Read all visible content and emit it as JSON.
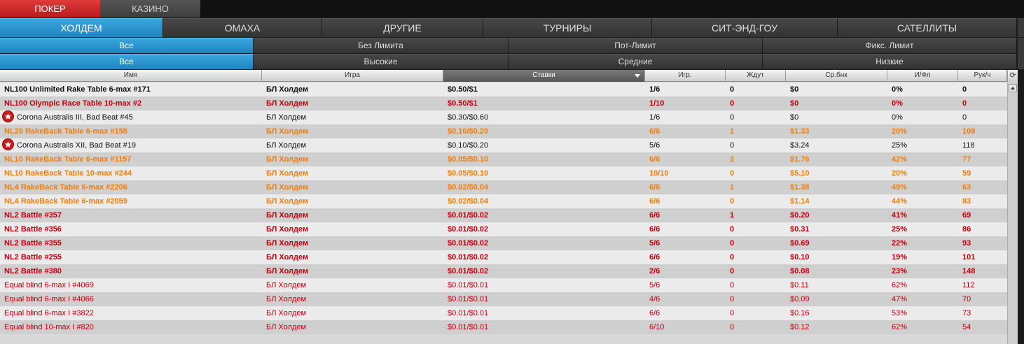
{
  "top_tabs": [
    {
      "label": "ПОКЕР",
      "active": true
    },
    {
      "label": "КАЗИНО",
      "active": false
    }
  ],
  "game_tabs": [
    "ХОЛДЕМ",
    "ОМАХА",
    "ДРУГИЕ",
    "ТУРНИРЫ",
    "СИТ-ЭНД-ГОУ",
    "САТЕЛЛИТЫ"
  ],
  "limit_tabs": [
    "Все",
    "Без Лимита",
    "Пот-Лимит",
    "Фикс. Лимит"
  ],
  "stake_tabs": [
    "Все",
    "Высокие",
    "Средние",
    "Низкие"
  ],
  "columns": [
    "Имя",
    "Игра",
    "Ставки",
    "Игр.",
    "Ждут",
    "Ср.бнк",
    "И/Фл",
    "Рук/ч"
  ],
  "icons": {
    "refresh": "refresh-icon",
    "star": "star-badge-icon",
    "sort": "sort-desc-icon"
  },
  "colors": {
    "accent": "#2196d3",
    "red": "#c3000d",
    "orange": "#f07d10"
  },
  "rows": [
    {
      "name": "NL100 Unlimited Rake Table 6-max #171",
      "game": "БЛ Холдем",
      "stakes": "$0.50/$1",
      "players": "1/6",
      "waiting": "0",
      "avg_pot": "$0",
      "flop": "0%",
      "hands": "0",
      "style": "black",
      "bold": true,
      "star": false
    },
    {
      "name": "NL100 Olympic Race Table 10-max #2",
      "game": "БЛ Холдем",
      "stakes": "$0.50/$1",
      "players": "1/10",
      "waiting": "0",
      "avg_pot": "$0",
      "flop": "0%",
      "hands": "0",
      "style": "red",
      "bold": true,
      "star": false
    },
    {
      "name": "Corona Australis III, Bad Beat #45",
      "game": "БЛ Холдем",
      "stakes": "$0.30/$0.60",
      "players": "1/6",
      "waiting": "0",
      "avg_pot": "$0",
      "flop": "0%",
      "hands": "0",
      "style": "black",
      "bold": false,
      "star": true
    },
    {
      "name": "NL20 RakeBack Table 6-max #158",
      "game": "БЛ Холдем",
      "stakes": "$0.10/$0.20",
      "players": "6/6",
      "waiting": "1",
      "avg_pot": "$1.33",
      "flop": "20%",
      "hands": "109",
      "style": "orange",
      "bold": true,
      "star": false
    },
    {
      "name": "Corona Australis XII, Bad Beat #19",
      "game": "БЛ Холдем",
      "stakes": "$0.10/$0.20",
      "players": "5/6",
      "waiting": "0",
      "avg_pot": "$3.24",
      "flop": "25%",
      "hands": "118",
      "style": "black",
      "bold": false,
      "star": true
    },
    {
      "name": "NL10 RakeBack Table 6-max #1157",
      "game": "БЛ Холдем",
      "stakes": "$0.05/$0.10",
      "players": "6/6",
      "waiting": "2",
      "avg_pot": "$1.76",
      "flop": "42%",
      "hands": "77",
      "style": "orange",
      "bold": true,
      "star": false
    },
    {
      "name": "NL10 RakeBack Table 10-max #244",
      "game": "БЛ Холдем",
      "stakes": "$0.05/$0.10",
      "players": "10/10",
      "waiting": "0",
      "avg_pot": "$5.10",
      "flop": "20%",
      "hands": "59",
      "style": "orange",
      "bold": true,
      "star": false
    },
    {
      "name": "NL4 RakeBack Table 6-max #2206",
      "game": "БЛ Холдем",
      "stakes": "$0.02/$0.04",
      "players": "6/6",
      "waiting": "1",
      "avg_pot": "$1.38",
      "flop": "49%",
      "hands": "63",
      "style": "orange",
      "bold": true,
      "star": false
    },
    {
      "name": "NL4 RakeBack Table 6-max #2059",
      "game": "БЛ Холдем",
      "stakes": "$0.02/$0.04",
      "players": "6/6",
      "waiting": "0",
      "avg_pot": "$1.14",
      "flop": "44%",
      "hands": "83",
      "style": "orange",
      "bold": true,
      "star": false
    },
    {
      "name": "NL2 Battle #357",
      "game": "БЛ Холдем",
      "stakes": "$0.01/$0.02",
      "players": "6/6",
      "waiting": "1",
      "avg_pot": "$0.20",
      "flop": "41%",
      "hands": "69",
      "style": "red",
      "bold": true,
      "star": false
    },
    {
      "name": "NL2 Battle #356",
      "game": "БЛ Холдем",
      "stakes": "$0.01/$0.02",
      "players": "6/6",
      "waiting": "0",
      "avg_pot": "$0.31",
      "flop": "25%",
      "hands": "86",
      "style": "red",
      "bold": true,
      "star": false
    },
    {
      "name": "NL2 Battle #355",
      "game": "БЛ Холдем",
      "stakes": "$0.01/$0.02",
      "players": "5/6",
      "waiting": "0",
      "avg_pot": "$0.69",
      "flop": "22%",
      "hands": "93",
      "style": "red",
      "bold": true,
      "star": false
    },
    {
      "name": "NL2 Battle #255",
      "game": "БЛ Холдем",
      "stakes": "$0.01/$0.02",
      "players": "6/6",
      "waiting": "0",
      "avg_pot": "$0.10",
      "flop": "19%",
      "hands": "101",
      "style": "red",
      "bold": true,
      "star": false
    },
    {
      "name": "NL2 Battle   #380",
      "game": "БЛ Холдем",
      "stakes": "$0.01/$0.02",
      "players": "2/6",
      "waiting": "0",
      "avg_pot": "$0.08",
      "flop": "23%",
      "hands": "148",
      "style": "red",
      "bold": true,
      "star": false
    },
    {
      "name": "Equal blind 6-max I  #4069",
      "game": "БЛ Холдем",
      "stakes": "$0.01/$0.01",
      "players": "5/6",
      "waiting": "0",
      "avg_pot": "$0.11",
      "flop": "62%",
      "hands": "112",
      "style": "red",
      "bold": false,
      "star": false
    },
    {
      "name": "Equal blind 6-max I  #4066",
      "game": "БЛ Холдем",
      "stakes": "$0.01/$0.01",
      "players": "4/6",
      "waiting": "0",
      "avg_pot": "$0.09",
      "flop": "47%",
      "hands": "70",
      "style": "red",
      "bold": false,
      "star": false
    },
    {
      "name": "Equal blind 6-max I  #3822",
      "game": "БЛ Холдем",
      "stakes": "$0.01/$0.01",
      "players": "6/6",
      "waiting": "0",
      "avg_pot": "$0.16",
      "flop": "53%",
      "hands": "73",
      "style": "red",
      "bold": false,
      "star": false
    },
    {
      "name": "Equal blind 10-max I  #820",
      "game": "БЛ Холдем",
      "stakes": "$0.01/$0.01",
      "players": "6/10",
      "waiting": "0",
      "avg_pot": "$0.12",
      "flop": "62%",
      "hands": "54",
      "style": "red",
      "bold": false,
      "star": false
    }
  ]
}
